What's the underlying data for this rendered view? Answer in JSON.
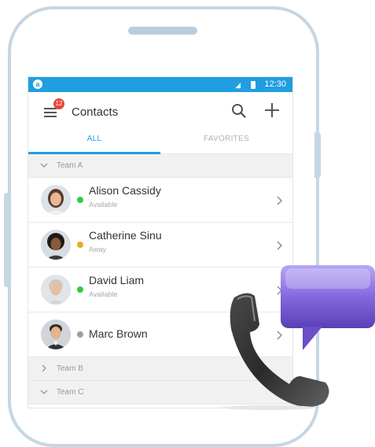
{
  "status_bar": {
    "app_icon": "a",
    "time": "12:30"
  },
  "app_bar": {
    "title": "Contacts",
    "badge_count": "12"
  },
  "tabs": [
    {
      "label": "ALL",
      "active": true
    },
    {
      "label": "FAVORITES",
      "active": false
    }
  ],
  "groups": [
    {
      "name": "Team A",
      "expanded": true
    },
    {
      "name": "Team B",
      "expanded": false
    },
    {
      "name": "Team C",
      "expanded": true
    }
  ],
  "contacts": [
    {
      "name": "Alison Cassidy",
      "status": "Available",
      "status_color": "#2ecc40"
    },
    {
      "name": "Catherine Sinu",
      "status": "Away",
      "status_color": "#f5a623"
    },
    {
      "name": "David Liam",
      "status": "Available",
      "status_color": "#2ecc40"
    },
    {
      "name": "Marc Brown",
      "status": "",
      "status_color": "#9e9e9e"
    }
  ],
  "colors": {
    "accent": "#1f9ee1",
    "badge": "#e8473c"
  },
  "icons": [
    "menu-icon",
    "search-icon",
    "add-icon",
    "chevron-right-icon",
    "phone-handset-icon",
    "chat-bubble-icon"
  ]
}
